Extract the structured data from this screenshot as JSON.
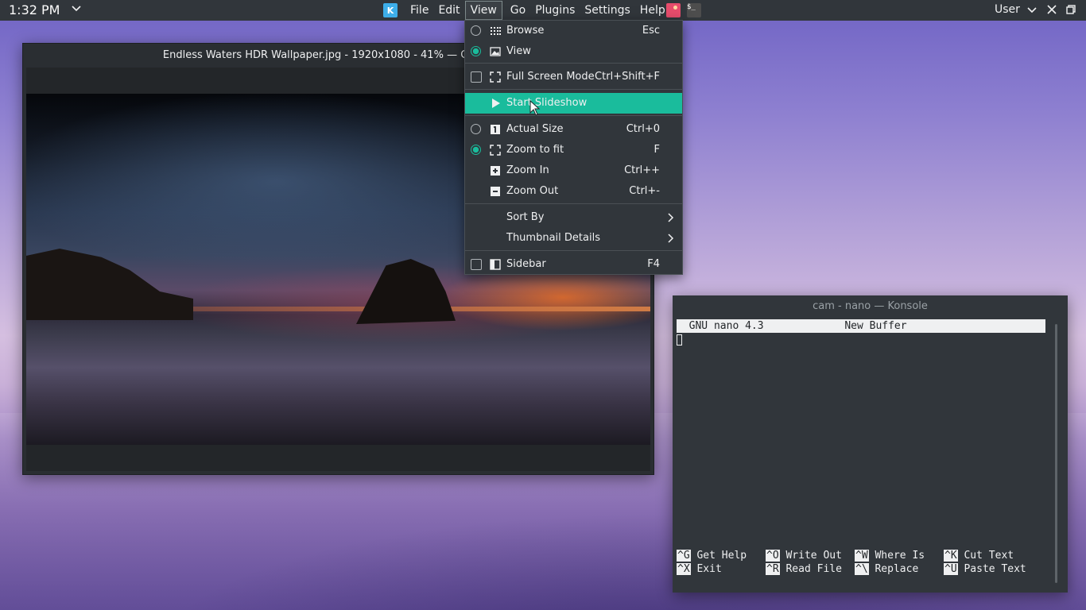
{
  "panel": {
    "clock": "1:32 PM",
    "menus": [
      "File",
      "Edit",
      "View",
      "Go",
      "Plugins",
      "Settings",
      "Help"
    ],
    "active_menu": "View",
    "user": "User",
    "tray_terminal_glyph": "$_"
  },
  "gwenview": {
    "title": "Endless Waters HDR Wallpaper.jpg - 1920x1080 - 41% — Gwenview"
  },
  "view_menu": {
    "browse": {
      "label": "Browse",
      "shortcut": "Esc"
    },
    "view": {
      "label": "View",
      "shortcut": ""
    },
    "full_screen": {
      "label": "Full Screen Mode",
      "shortcut": "Ctrl+Shift+F"
    },
    "slideshow": {
      "label": "Start Slideshow",
      "shortcut": ""
    },
    "actual_size": {
      "label": "Actual Size",
      "shortcut": "Ctrl+0"
    },
    "zoom_fit": {
      "label": "Zoom to fit",
      "shortcut": "F"
    },
    "zoom_in": {
      "label": "Zoom In",
      "shortcut": "Ctrl++"
    },
    "zoom_out": {
      "label": "Zoom Out",
      "shortcut": "Ctrl+-"
    },
    "sort_by": {
      "label": "Sort By"
    },
    "thumbnail_details": {
      "label": "Thumbnail Details"
    },
    "sidebar": {
      "label": "Sidebar",
      "shortcut": "F4"
    }
  },
  "konsole": {
    "title": "cam - nano — Konsole",
    "nano_header": "  GNU nano 4.3             New Buffer",
    "shortcuts": [
      {
        "key": "^G",
        "label": " Get Help"
      },
      {
        "key": "^O",
        "label": " Write Out"
      },
      {
        "key": "^W",
        "label": " Where Is"
      },
      {
        "key": "^K",
        "label": " Cut Text"
      },
      {
        "key": "^X",
        "label": " Exit"
      },
      {
        "key": "^R",
        "label": " Read File"
      },
      {
        "key": "^\\",
        "label": " Replace"
      },
      {
        "key": "^U",
        "label": " Paste Text"
      }
    ]
  },
  "colors": {
    "accent": "#1abc9c",
    "panel": "#31363b",
    "text": "#eff0f1"
  }
}
